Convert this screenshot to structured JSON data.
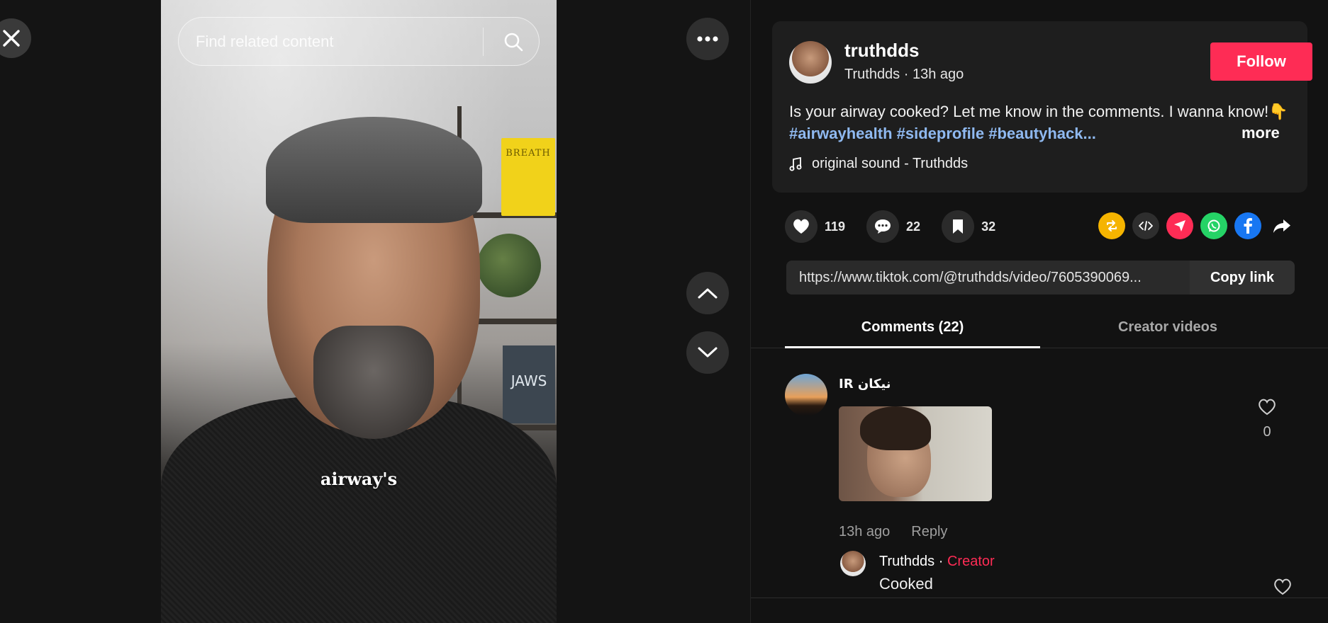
{
  "search": {
    "placeholder": "Find related content"
  },
  "video": {
    "caption": "airway's",
    "book_yellow": "BREATH",
    "book_dark": "JAWS"
  },
  "author": {
    "username": "truthdds",
    "display_name": "Truthdds",
    "time_ago": "13h ago",
    "sub_line": "Truthdds · 13h ago",
    "follow_label": "Follow"
  },
  "post": {
    "description": "Is your airway cooked? Let me know in the comments. I wanna know!👇",
    "hashtags": "#airwayhealth #sideprofile #beautyhack...",
    "more_label": "more",
    "sound": "original sound - Truthdds"
  },
  "stats": {
    "likes": "119",
    "comments": "22",
    "saves": "32"
  },
  "share_icons": [
    "repost-icon",
    "embed-icon",
    "send-icon",
    "whatsapp-icon",
    "facebook-icon",
    "share-arrow-icon"
  ],
  "link": {
    "url": "https://www.tiktok.com/@truthdds/video/7605390069...",
    "copy_label": "Copy link"
  },
  "tabs": [
    {
      "label": "Comments (22)",
      "active": true
    },
    {
      "label": "Creator videos",
      "active": false
    }
  ],
  "comments": [
    {
      "author": "IR نیکان",
      "time": "13h ago",
      "reply_label": "Reply",
      "like_count": "0",
      "reply": {
        "author": "Truthdds",
        "separator": " · ",
        "badge": "Creator",
        "text": "Cooked"
      }
    }
  ],
  "colors": {
    "accent": "#fe2c55",
    "hashtag": "#8fb9f0",
    "repost": "#f5b400",
    "whatsapp": "#25d366",
    "facebook": "#1877f2"
  }
}
